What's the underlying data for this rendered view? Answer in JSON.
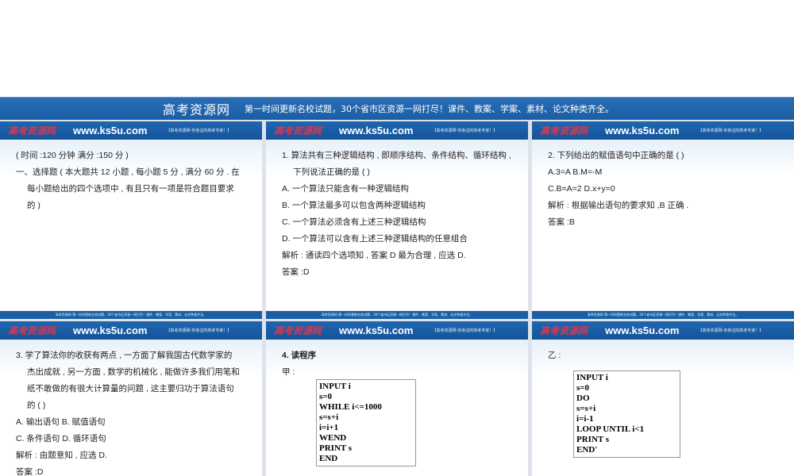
{
  "banner": {
    "title": "高考资源网",
    "slogan": "第一时间更新名校试题，30个省市区资源一网打尽！课件、教案、学案、素材、论文种类齐全。"
  },
  "slide_header": {
    "logo": "高考资源网",
    "url": "www.ks5u.com",
    "tagline": "【高考资源网-你身边的高考专家！】"
  },
  "slide_footer": "高考资源网  第一时间更新名校试题，30个省市区资源一网打尽！课件、教案、学案、素材、论文种类齐全。",
  "slides": [
    {
      "lines": [
        "( 时间 :120 分钟    满分 :150 分 )",
        "一、选择题 ( 本大题共 12 小题 , 每小题 5 分 , 满分 60 分 . 在",
        "每小题给出的四个选项中 , 有且只有一项是符合题目要求",
        "的 )"
      ]
    },
    {
      "lines": [
        "1. 算法共有三种逻辑结构 , 即顺序结构、条件结构、循环结构 ,",
        "下列说法正确的是 (    )",
        "A. 一个算法只能含有一种逻辑结构",
        "B. 一个算法最多可以包含两种逻辑结构",
        "C. 一个算法必须含有上述三种逻辑结构",
        "D. 一个算法可以含有上述三种逻辑结构的任意组合",
        "解析 : 通读四个选项知 , 答案 D 最为合理 , 应选 D.",
        "答案 :D"
      ]
    },
    {
      "lines": [
        "2. 下列给出的赋值语句中正确的是 (    )",
        "A.3=A                  B.M=-M",
        "C.B=A=2           D.x+y=0",
        "解析 : 根据输出语句的要求知 ,B 正确 .",
        "答案 :B"
      ]
    },
    {
      "lines": [
        "3. 学了算法你的收获有两点 , 一方面了解我国古代数学家的",
        "杰出成就 , 另一方面 , 数学的机械化 , 能做许多我们用笔和",
        "纸不敢做的有很大计算量的问题 , 这主要归功于算法语句",
        "的 (    )",
        "A. 输出语句        B. 赋值语句",
        "C. 条件语句        D. 循环语句",
        "解析 : 由题意知 , 应选 D.",
        "答案 :D"
      ]
    },
    {
      "title": "4. 读程序",
      "label": "甲 :",
      "code": [
        "INPUT  i",
        "s=0",
        "WHILE  i<=1000",
        "s=s+i",
        "i=i+1",
        "WEND",
        "PRINT  s",
        "END"
      ]
    },
    {
      "label": "乙 :",
      "code": [
        "INPUT  i",
        "s=0",
        "DO",
        "s=s+i",
        "i=i-1",
        "LOOP UNTIL  i<1",
        "PRINT  s",
        "END'"
      ]
    }
  ]
}
